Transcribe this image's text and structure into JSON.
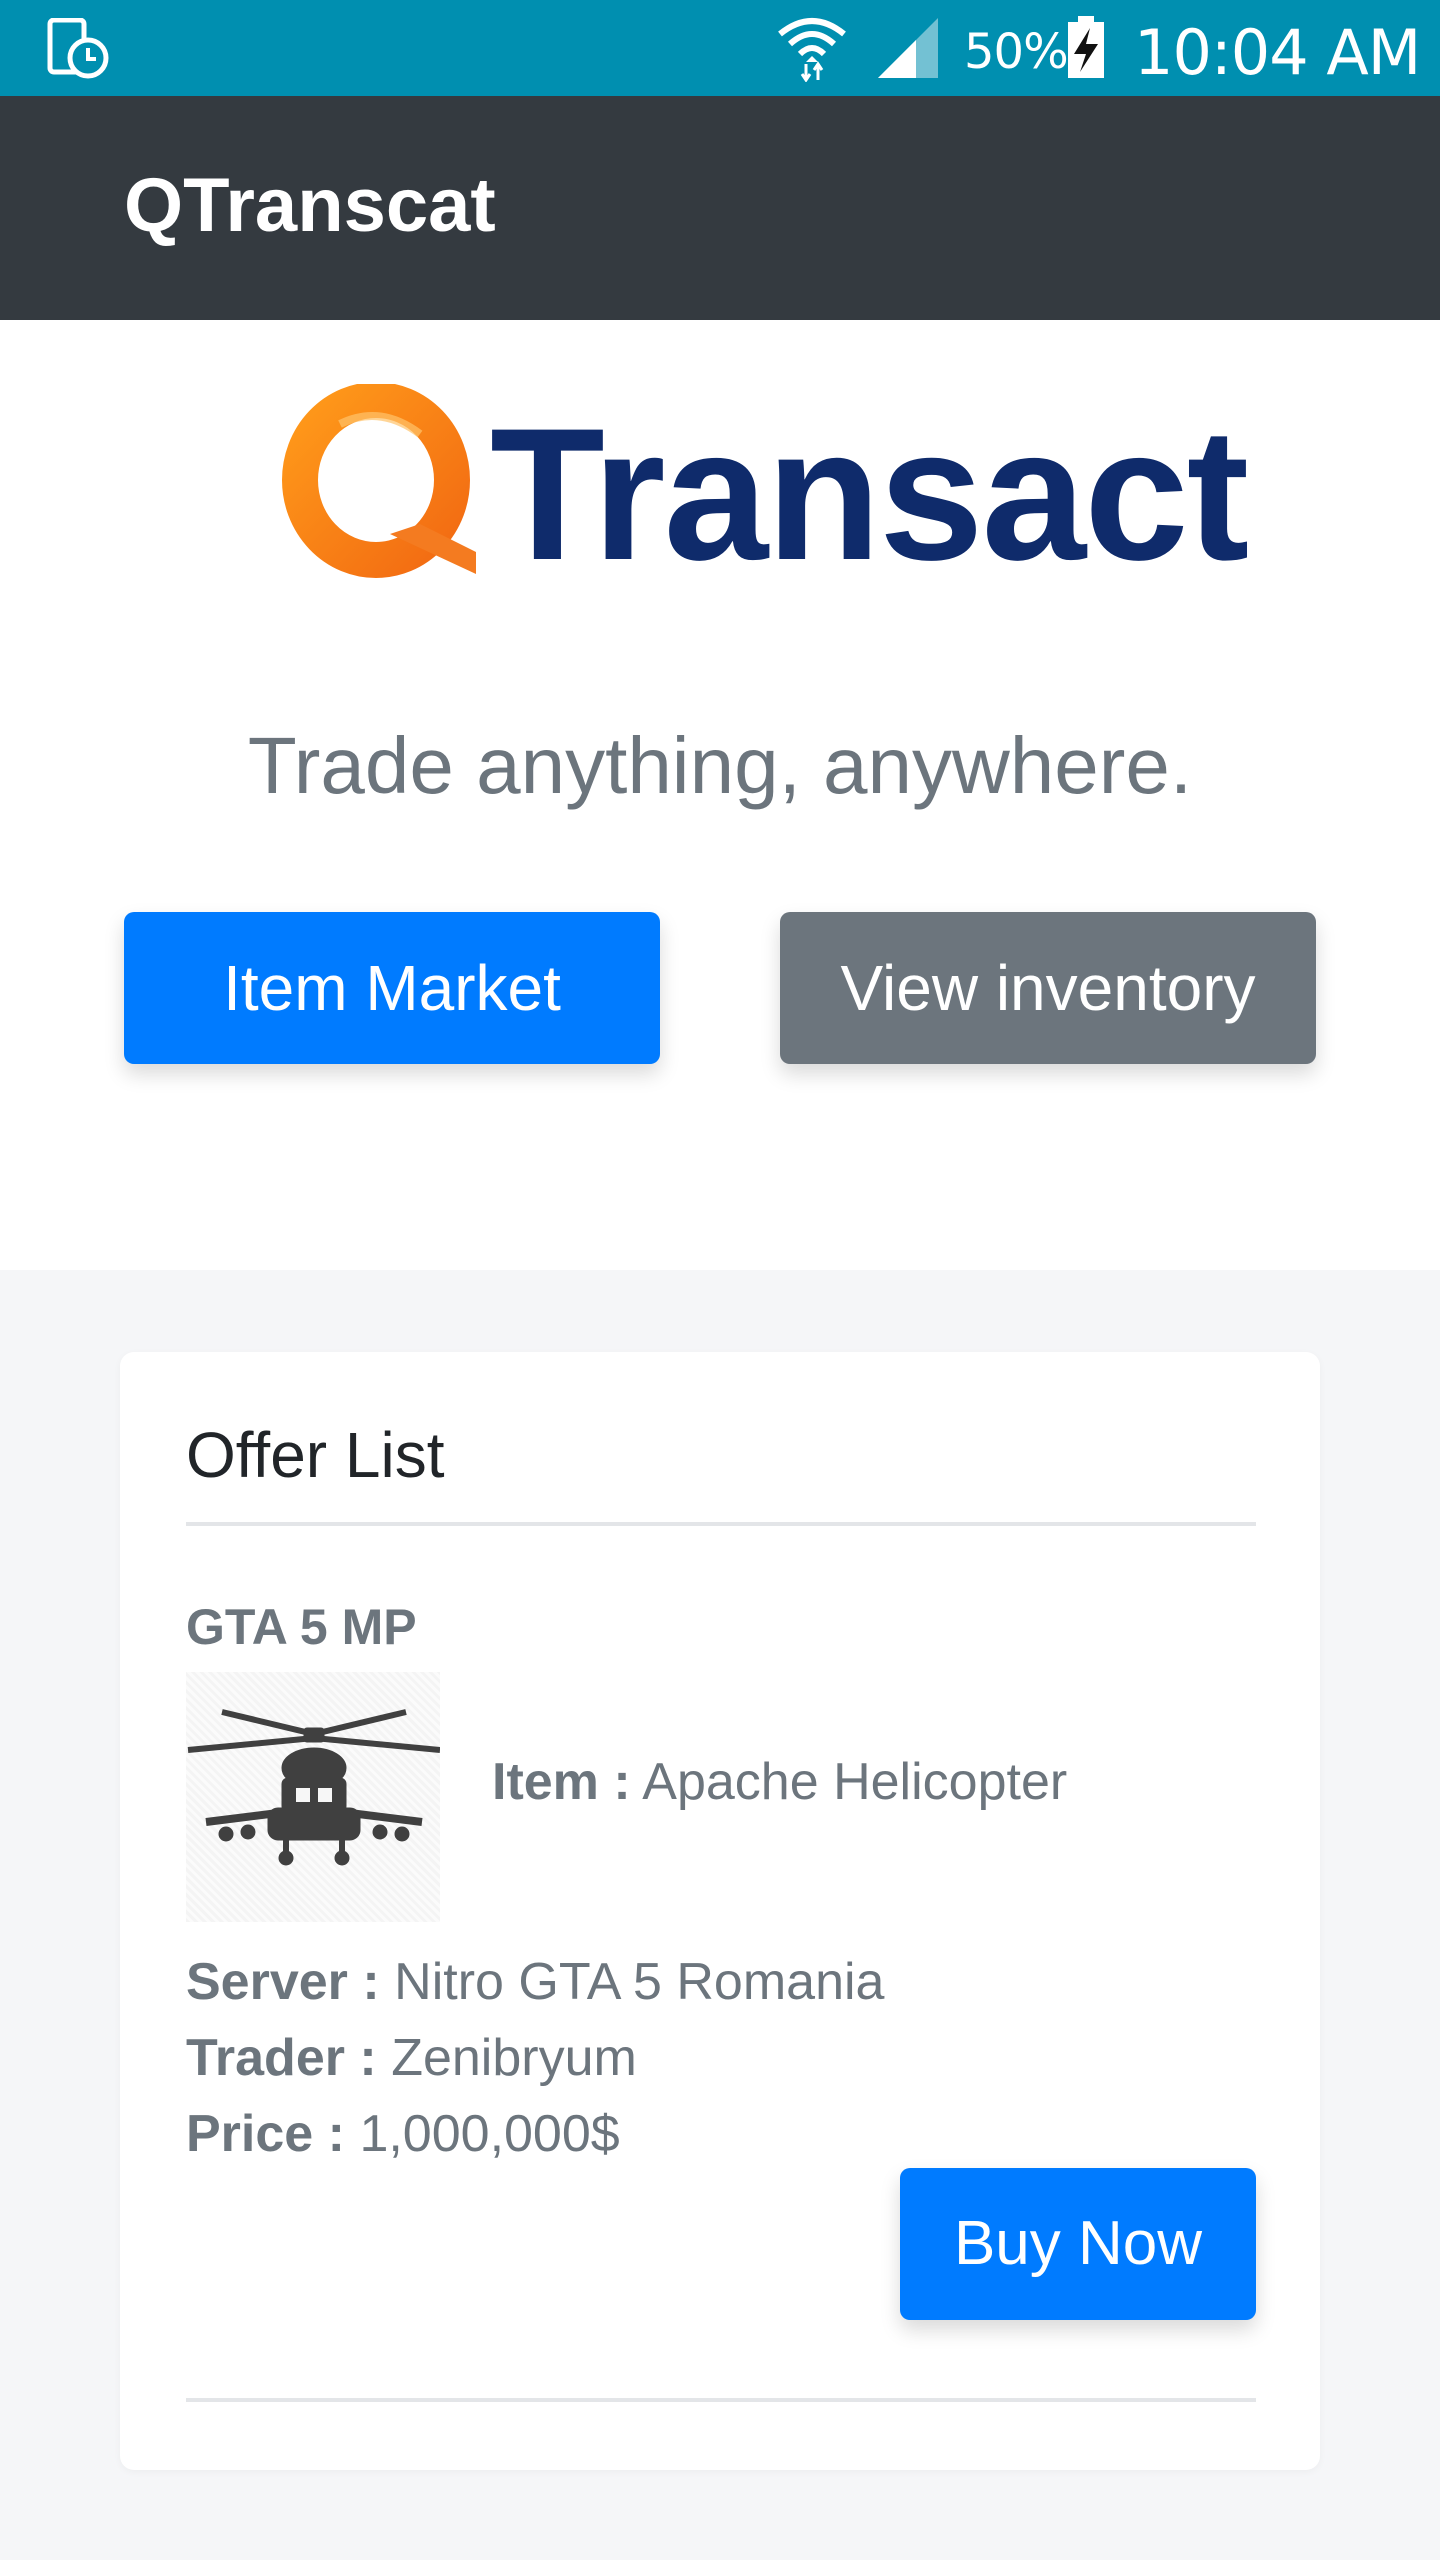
{
  "status_bar": {
    "battery_percent": "50%",
    "time": "10:04 AM",
    "icons": [
      "notification-clock-icon",
      "wifi-icon",
      "signal-icon",
      "battery-charging-icon"
    ]
  },
  "app_bar": {
    "title": "QTranscat"
  },
  "hero": {
    "logo_text": "Transact",
    "logo_letter": "Q",
    "tagline": "Trade anything, anywhere.",
    "primary_button": "Item Market",
    "secondary_button": "View inventory"
  },
  "offer_list": {
    "title": "Offer List",
    "offers": [
      {
        "game": "GTA 5 MP",
        "item_label": "Item :",
        "item_value": "Apache Helicopter",
        "server_label": "Server :",
        "server_value": "Nitro GTA 5 Romania",
        "trader_label": "Trader :",
        "trader_value": "Zenibryum",
        "price_label": "Price :",
        "price_value": "1,000,000$",
        "buy_button": "Buy Now",
        "image_icon": "helicopter-icon"
      }
    ]
  },
  "colors": {
    "status_bar": "#008fb0",
    "app_bar": "#343a40",
    "primary": "#007bff",
    "secondary": "#6c757d",
    "logo_navy": "#0f2b6b",
    "logo_orange": "#f47b20"
  }
}
